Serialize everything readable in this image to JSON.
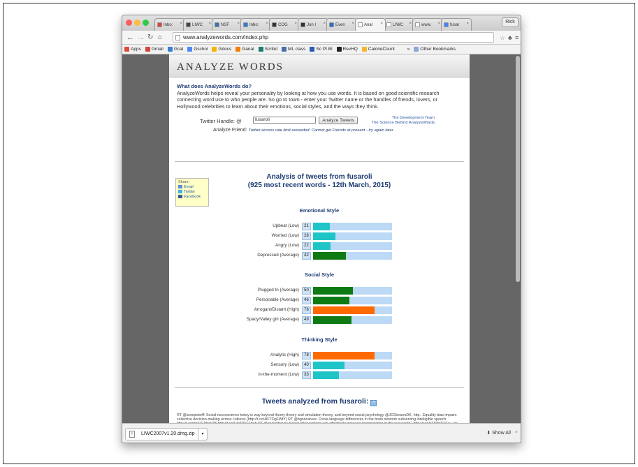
{
  "browser": {
    "tabs": [
      {
        "label": "Inbo:",
        "icon": "gmail-icon",
        "color": "#d44638"
      },
      {
        "label": "LIWC",
        "icon": "liwc-icon",
        "color": "#444444"
      },
      {
        "label": "NSF",
        "icon": "nsf-icon",
        "color": "#3a6fb0"
      },
      {
        "label": "Inbo:",
        "icon": "inbox-icon",
        "color": "#2b7bd6"
      },
      {
        "label": "COG",
        "icon": "grid-icon",
        "color": "#333333"
      },
      {
        "label": "Jon I",
        "icon": "pin-icon",
        "color": "#333333"
      },
      {
        "label": "Even",
        "icon": "eventbrite-icon",
        "color": "#2b6cc4"
      },
      {
        "label": "Anal",
        "icon": "page-icon",
        "color": "#ffffff",
        "active": true
      },
      {
        "label": "LIWC",
        "icon": "page-icon",
        "color": "#ffffff"
      },
      {
        "label": "www.",
        "icon": "page-icon",
        "color": "#ffffff"
      },
      {
        "label": "fusar",
        "icon": "google-icon",
        "color": "#4285f4"
      }
    ],
    "profile": "Rick",
    "url": "www.analyzewords.com/index.php",
    "bookmarks": [
      {
        "label": "Apps",
        "color": "#e04a3a"
      },
      {
        "label": "Gmail",
        "color": "#d44638"
      },
      {
        "label": "Gcal",
        "color": "#3b7fd4"
      },
      {
        "label": "Gschol",
        "color": "#4c8bf5"
      },
      {
        "label": "Gdocs",
        "color": "#f4b400"
      },
      {
        "label": "Ganal",
        "color": "#f57c00"
      },
      {
        "label": "Scribd",
        "color": "#1e7b75"
      },
      {
        "label": "ML class",
        "color": "#4a6fa5"
      },
      {
        "label": "Sc Pt Bl",
        "color": "#2a5db0"
      },
      {
        "label": "RevHQ",
        "color": "#222222"
      },
      {
        "label": "CalorieCount",
        "color": "#f0b72f"
      }
    ],
    "bookmarks_more": "»",
    "other_bookmarks": "Other Bookmarks"
  },
  "site": {
    "logo": "ANALYZE WORDS",
    "intro_heading": "What does AnalyzeWords do?",
    "intro_text": "AnalyzeWords helps reveal your personality by looking at how you use words. It is based on good scientific research connecting word use to who people are. So go to town - enter your Twitter name or the handles of friends, lovers, or Hollywood celebrities to learn about their emotions, social styles, and the ways they think.",
    "handle_label": "Twitter Handle: @",
    "handle_value": "fusaroli",
    "analyze_button": "Analyze Tweets",
    "link_team": "The Development Team",
    "link_science": "The Science Behind AnalyzeWords",
    "friend_label": "Analyze Friend:",
    "friend_message": "Twitter access rate limit exceeded: Cannot get Friends at present - try again later",
    "share": {
      "label": "Share:",
      "email": "Email",
      "twitter": "Twitter",
      "facebook": "Facebook"
    },
    "analysis_title_1": "Analysis of tweets from fusaroli",
    "analysis_title_2": "(925 most recent words - 12th March, 2015)",
    "sections": [
      {
        "title": "Emotional Style",
        "rows": [
          {
            "label": "Upbeat (Low)",
            "score": 21,
            "level": "low"
          },
          {
            "label": "Worried (Low)",
            "score": 28,
            "level": "low"
          },
          {
            "label": "Angry (Low)",
            "score": 22,
            "level": "low"
          },
          {
            "label": "Depressed (Average)",
            "score": 42,
            "level": "average"
          }
        ]
      },
      {
        "title": "Social Style",
        "rows": [
          {
            "label": "Plugged In (Average)",
            "score": 50,
            "level": "average"
          },
          {
            "label": "Personable (Average)",
            "score": 46,
            "level": "average"
          },
          {
            "label": "Arrogant/Distant (High)",
            "score": 78,
            "level": "high"
          },
          {
            "label": "Spacy/Valley girl (Average)",
            "score": 49,
            "level": "average"
          }
        ]
      },
      {
        "title": "Thinking Style",
        "rows": [
          {
            "label": "Analytic (High)",
            "score": 78,
            "level": "high"
          },
          {
            "label": "Sensory (Low)",
            "score": 40,
            "level": "low"
          },
          {
            "label": "In-the-moment (Low)",
            "score": 33,
            "level": "low"
          }
        ]
      }
    ],
    "level_colors": {
      "low": "#1fc4c7",
      "average": "#0e7a14",
      "high": "#ff6a00"
    },
    "tweets_heading": "Tweets analyzed from fusaroli:",
    "tweets_text": "RT @aroepstorff: Social neuroscience today is way beyond theory-theory and simulation theory, and beyond social psychology @JCSkewesDK, http.. Equality bias impairs collective decision-making across cultures (http://t.co/4iFTOgFWfY) RT @bgoncalves: Cross-language differences in the brain network subserving intelligible speech http://t.co/mrXXVdwkOB http://t.co/L4eRDGEbsb RT @jayvanbavel: Social Interventions can effectively increase #cooperation in the real world | http://t.co/kTIPbPOjEz | via @David_G_Rand RT @twiecki: Model-based cognitive neuroscience approaches to computational psychiatry: clustering and classification http://t.co/IJf..."
  },
  "downloads": {
    "file": "LIWC2007v1.20.dmg.zip",
    "show_all": "Show All",
    "close": "×"
  }
}
